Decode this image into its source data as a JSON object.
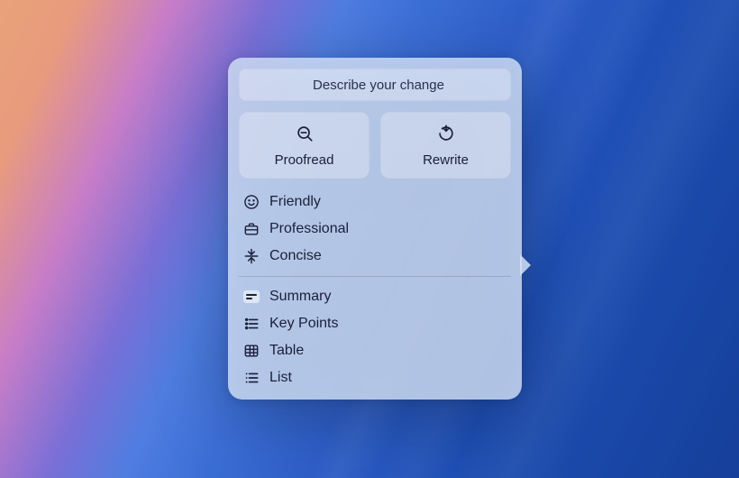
{
  "describe": {
    "placeholder": "Describe your change"
  },
  "actions": {
    "proofread": "Proofread",
    "rewrite": "Rewrite"
  },
  "tones": [
    {
      "icon": "smile-icon",
      "label": "Friendly"
    },
    {
      "icon": "briefcase-icon",
      "label": "Professional"
    },
    {
      "icon": "collapse-icon",
      "label": "Concise"
    }
  ],
  "formats": [
    {
      "icon": "summary-icon",
      "label": "Summary"
    },
    {
      "icon": "keypoints-icon",
      "label": "Key Points"
    },
    {
      "icon": "table-icon",
      "label": "Table"
    },
    {
      "icon": "list-icon",
      "label": "List"
    }
  ]
}
